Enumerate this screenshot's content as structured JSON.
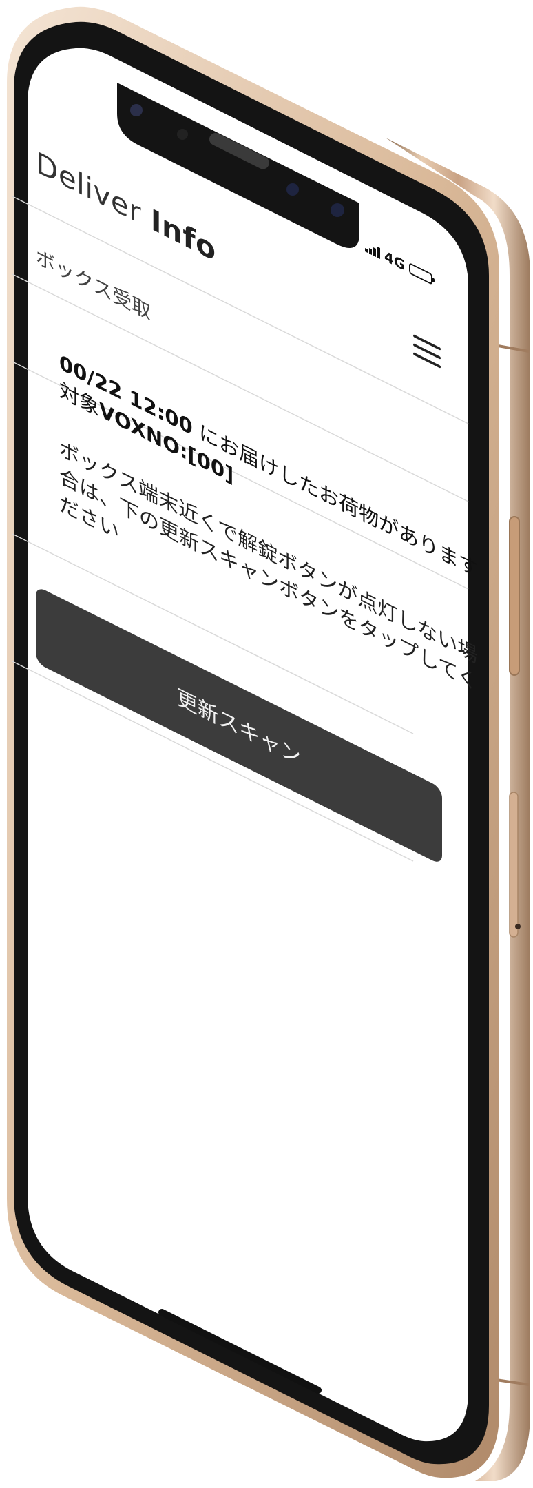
{
  "app": {
    "title_light": "Deliver",
    "title_bold": "Info",
    "section_label": "ボックス受取"
  },
  "status_bar": {
    "network": "4G",
    "battery_level": 0.8
  },
  "delivery": {
    "datetime": "00/22 12:00",
    "delivered_text": "にお届けしたお荷物があります",
    "target_prefix": "対象",
    "box_number": "VOXNO:[00]"
  },
  "notice": {
    "line1": "ボックス端末近くで解錠ボタンが点灯しない場",
    "line2": "合は、下の更新スキャンボタンをタップしてく",
    "line3": "ださい"
  },
  "actions": {
    "refresh_scan_label": "更新スキャン"
  },
  "icons": {
    "menu": "hamburger-menu-icon",
    "signal": "cellular-signal-icon",
    "battery": "battery-icon"
  },
  "colors": {
    "frame_gold": "#d6b596",
    "bezel": "#141414",
    "button_bg": "#3c3c3c",
    "screen_bg": "#ffffff"
  }
}
